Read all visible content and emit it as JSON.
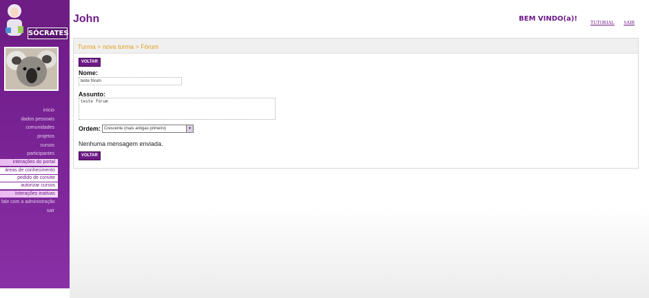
{
  "logo": {
    "text": "SÓCRATES"
  },
  "header": {
    "user_name": "John",
    "welcome": "BEM VINDO(a)!",
    "links": [
      "TUTORIAL",
      "SAIR"
    ]
  },
  "sidebar": {
    "items": [
      {
        "label": "início",
        "style": "plain"
      },
      {
        "label": "dados pessoais",
        "style": "plain"
      },
      {
        "label": "comunidades",
        "style": "plain"
      },
      {
        "label": "projetos",
        "style": "plain"
      },
      {
        "label": "cursos",
        "style": "plain"
      },
      {
        "label": "participantes",
        "style": "plain"
      },
      {
        "label": "interações do portal",
        "style": "tab-header"
      },
      {
        "label": "áreas de conhecimento",
        "style": "tab"
      },
      {
        "label": "pedido de convite",
        "style": "tab"
      },
      {
        "label": "autorizar cursos",
        "style": "tab"
      },
      {
        "label": "interações inativas",
        "style": "tab-header"
      },
      {
        "label": "fale com a administração",
        "style": "plain-wide"
      },
      {
        "label": "sair",
        "style": "plain"
      }
    ]
  },
  "main": {
    "breadcrumb": "Turma > nova turma > Fórum",
    "voltar_label": "VOLTAR",
    "nome_label": "Nome:",
    "nome_value": "teste fórum",
    "assunto_label": "Assunto:",
    "assunto_value": "teste fórum",
    "ordem_label": "Ordem:",
    "ordem_selected": "Crescente (mais antigas primeiro)",
    "empty_message": "Nenhuma mensagem enviada."
  },
  "colors": {
    "brand": "#6e1a86",
    "breadcrumb": "#e4a020"
  }
}
